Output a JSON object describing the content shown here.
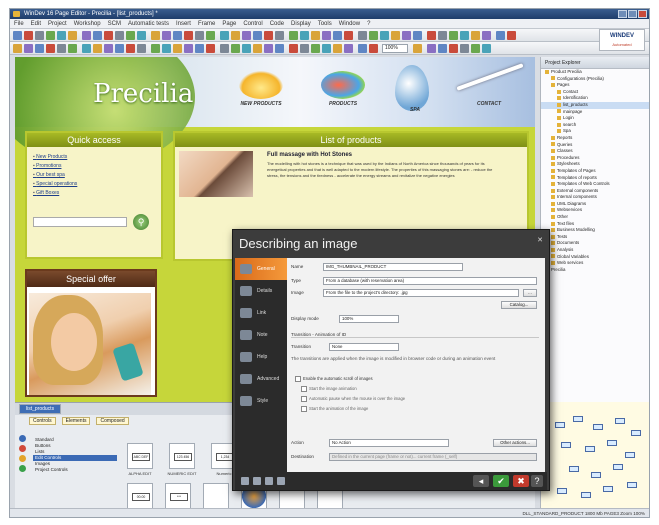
{
  "window": {
    "title": "WinDev 16 Page Editor - Precilia - [list_products] *"
  },
  "menu": [
    "File",
    "Edit",
    "Project",
    "Workshop",
    "SCM",
    "Automatic tests",
    "Insert",
    "Frame",
    "Page",
    "Control",
    "Code",
    "Display",
    "Tools",
    "Window",
    "?"
  ],
  "toolbar": {
    "zoom": "100%",
    "logo": "WINDEV",
    "logo_sub": "Automated"
  },
  "site": {
    "logo": "Precilia",
    "nav": [
      "NEW PRODUCTS",
      "PRODUCTS",
      "SPA",
      "CONTACT"
    ],
    "quick_access": {
      "title": "Quick access",
      "links": [
        "New Products",
        "Promotions",
        "Our best spa",
        "Special operations",
        "Gift Boxes"
      ],
      "search_placeholder": ""
    },
    "products": {
      "title": "List of products",
      "item_title": "Full massage with Hot Stones",
      "item_desc": "The modelling with hot stones is a technique that was used by the Indians of North America since thousands of years for its energetical properties and that is well adapted to the modern lifestyle. The properties of this massaging stones are: - reduce the stress, the tensions and the tiredness - accelerate the energy streams and revitalize the negative energies"
    },
    "special_offer": {
      "title": "Special offer"
    }
  },
  "explorer": {
    "title": "Project Explorer",
    "items": [
      "Product Precilia",
      "Configurations (Precilia)",
      "Pages",
      "Contact",
      "Identification",
      "list_products",
      "mainpage",
      "Login",
      "search",
      "Spa",
      "Reports",
      "Queries",
      "Classes",
      "Procedures",
      "Stylesheets",
      "Templates of Pages",
      "Templates of reports",
      "Templates of Web Controls",
      "External components",
      "Internal components",
      "UML Diagrams",
      "Webservices",
      "Other",
      "Text files",
      "Business Modelling",
      "Tests",
      "Documents",
      "Analysis",
      "Global Variables",
      "Web services",
      "Precilia"
    ],
    "selected_index": 5
  },
  "catalog": {
    "tab": "list_products",
    "subtabs": [
      "Controls",
      "Elements",
      "Composed"
    ],
    "categories": [
      "Standard",
      "Buttons",
      "Lists",
      "Edit Controls",
      "Images",
      "Project Controls"
    ],
    "selected_category": "Edit Controls",
    "controls": [
      {
        "label": "ALPHA EDIT",
        "inner": "ABC DEF"
      },
      {
        "label": "NUMERIC EDIT",
        "inner": "123 456"
      },
      {
        "label": "Numeric",
        "inner": "1,234"
      },
      {
        "label": "",
        "inner": ""
      },
      {
        "label": "",
        "inner": "00.00"
      },
      {
        "label": "",
        "inner": "***"
      },
      {
        "label": "",
        "inner": ""
      },
      {
        "label": "",
        "inner": ""
      },
      {
        "label": "",
        "inner": ""
      },
      {
        "label": "",
        "inner": ""
      }
    ]
  },
  "dialog": {
    "title": "Describing an image",
    "sidebar": [
      "General",
      "Details",
      "Link",
      "Note",
      "Help",
      "Advanced",
      "Style"
    ],
    "active_tab": "General",
    "fields": {
      "name_label": "Name",
      "name_value": "IMG_THUMBNAIL_PRODUCT",
      "type_label": "Type",
      "type_value": "From a database (with reservation area)",
      "image_label": "Image",
      "image_value": "From the file to the project's directory: .jpg",
      "display_label": "Display mode",
      "display_value": "100%",
      "catalog_btn": "Catalog...",
      "transition_section": "Transition - Animation of ID",
      "transition_label": "Transition",
      "transition_value": "None",
      "transition_note": "The transitions are applied when the image is modified in browser code or during an animation event",
      "enable_animation": "Enable the automatic scroll of images",
      "opt1": "Start the image animation",
      "opt2": "Automatic pause when the mouse is over the image",
      "opt3": "Start the animation of the image",
      "action_label": "Action",
      "action_value": "No Action",
      "action_btn": "Other actions...",
      "destination_label": "Destination",
      "destination_value": "Defined in the current page (frame or not)... current frame (_self)"
    }
  },
  "status": {
    "text": "DLL_STANDARD_PRODUCT   1800 Mb   PAGE3   Zoom 100%"
  }
}
